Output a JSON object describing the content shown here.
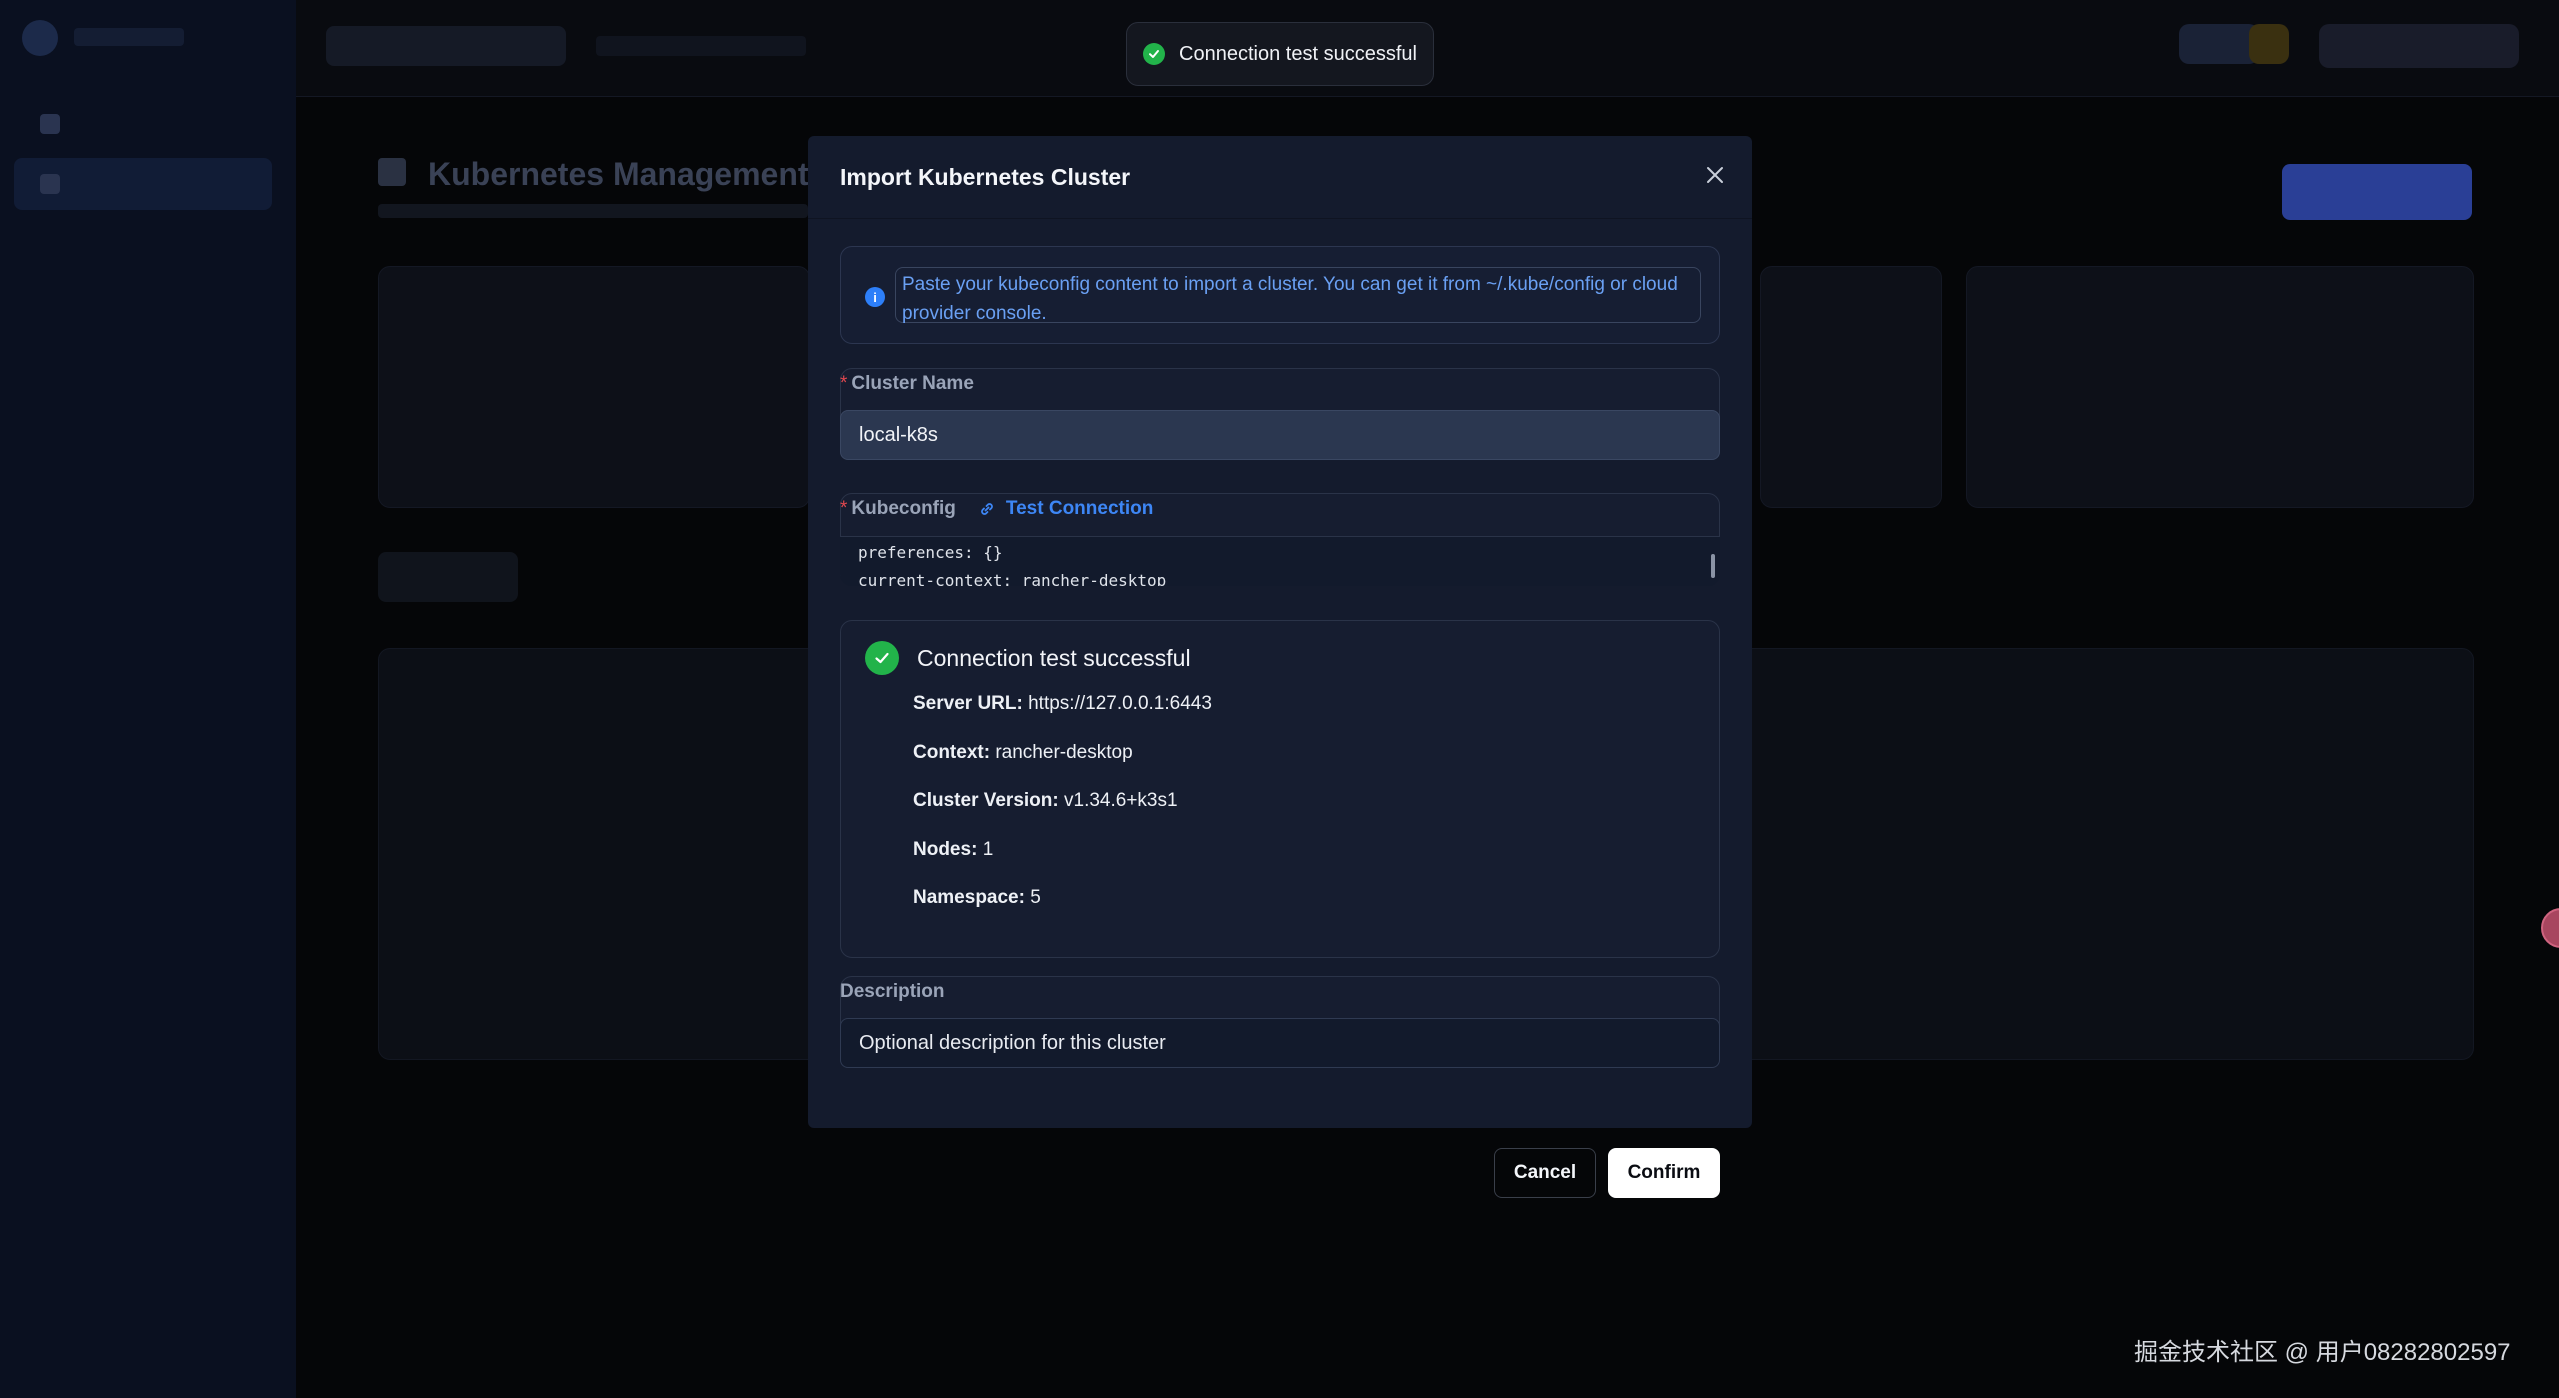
{
  "toast": {
    "message": "Connection test successful"
  },
  "modal": {
    "title": "Import Kubernetes Cluster",
    "info_text": "Paste your kubeconfig content to import a cluster. You can get it from ~/.kube/config or cloud provider console.",
    "cluster_name": {
      "label": "Cluster Name",
      "required_mark": "*",
      "value": "local-k8s"
    },
    "kubeconfig": {
      "label": "Kubeconfig",
      "required_mark": "*",
      "test_connection_label": "Test Connection",
      "lines": [
        "preferences: {}",
        "current-context: rancher-desktop"
      ]
    },
    "result": {
      "status": "Connection test successful",
      "server_url_label": "Server URL:",
      "server_url": "https://127.0.0.1:6443",
      "context_label": "Context:",
      "context": "rancher-desktop",
      "cluster_version_label": "Cluster Version:",
      "cluster_version": "v1.34.6+k3s1",
      "nodes_label": "Nodes:",
      "nodes": "1",
      "namespace_label": "Namespace:",
      "namespace": "5"
    },
    "description": {
      "label": "Description",
      "placeholder": "Optional description for this cluster"
    }
  },
  "buttons": {
    "cancel": "Cancel",
    "confirm": "Confirm"
  },
  "background": {
    "page_title": "Kubernetes Management",
    "sidebar_items": [
      "",
      ""
    ]
  },
  "watermark": "掘金技术社区 @ 用户08282802597",
  "colors": {
    "success": "#22b34a",
    "accent": "#3d86f5",
    "required": "#e0484f"
  }
}
